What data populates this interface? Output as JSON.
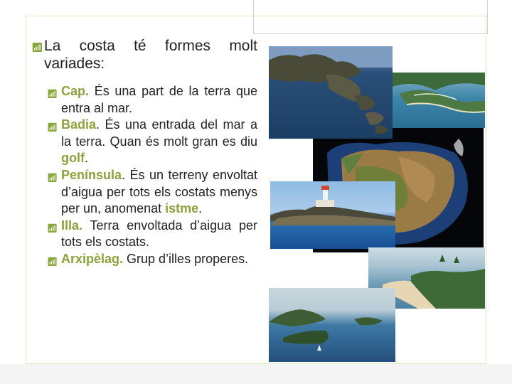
{
  "intro": {
    "line1": "La costa té formes molt",
    "line2": "variades:"
  },
  "items": [
    {
      "term": "Cap.",
      "text": " És una part de la terra que entra al mar."
    },
    {
      "term": "Badia",
      "text": ". És una entrada del mar a la terra. Quan és molt gran es diu ",
      "term2": "golf",
      "text2": "."
    },
    {
      "term": "Península",
      "text": ". És un terreny envoltat d’aigua per tots els costats menys per un, anomenat ",
      "term2": "istme",
      "text2": "."
    },
    {
      "term": "Illa.",
      "text": " Terra envoltada d’aigua per tots els costats."
    },
    {
      "term": "Arxipèlag.",
      "text": " Grup d’illes properes."
    }
  ],
  "bullet_icon": "signal-bars-icon",
  "accent_color": "#8aa33a",
  "images": [
    "cape-photo",
    "bay-aerial-photo",
    "iberian-peninsula-satellite-photo",
    "lighthouse-peninsula-photo",
    "beach-bay-photo",
    "island-photo"
  ]
}
